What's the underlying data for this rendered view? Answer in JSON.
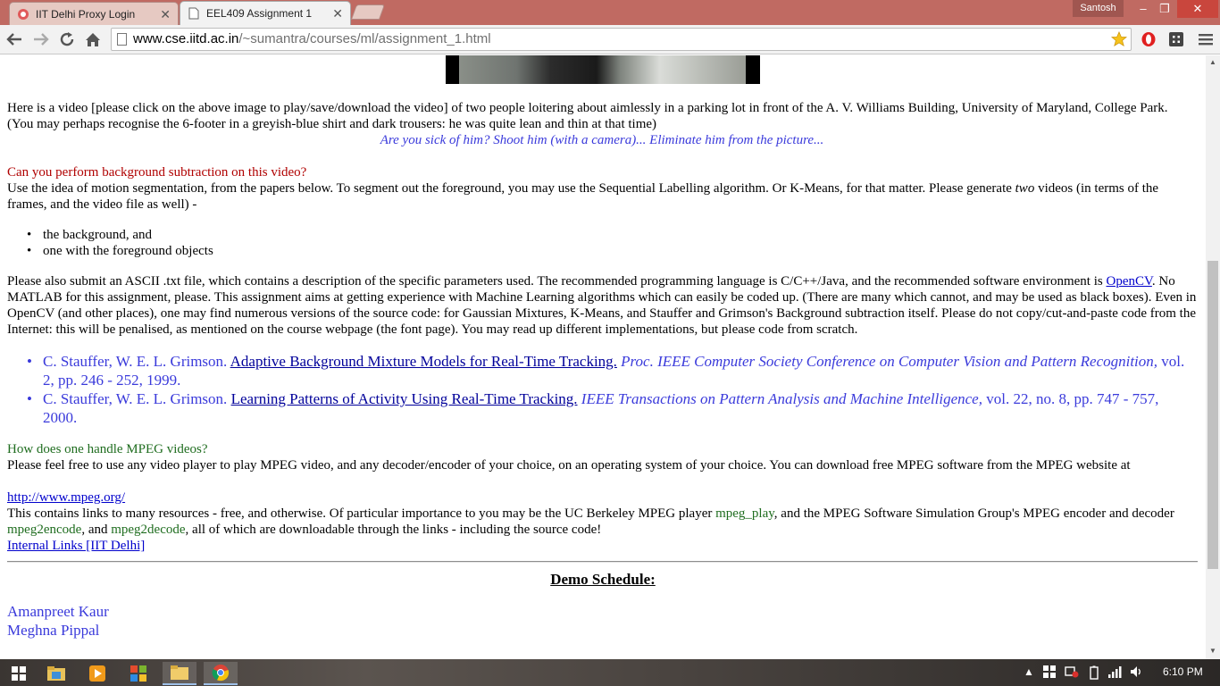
{
  "browser": {
    "tabs": [
      {
        "title": "IIT Delhi Proxy Login",
        "active": false
      },
      {
        "title": "EEL409 Assignment 1",
        "active": true
      }
    ],
    "user_name": "Santosh",
    "url_host": "www.cse.iitd.ac.in",
    "url_path": "/~sumantra/courses/ml/assignment_1.html",
    "window_controls": {
      "minimize": "–",
      "maximize": "❐",
      "close": "✕"
    }
  },
  "content": {
    "intro": "Here is a video [please click on the above image to play/save/download the video] of two people loitering about aimlessly in a parking lot in front of the A. V. Williams Building, University of Maryland, College Park. (You may perhaps recognise the 6-footer in a greyish-blue shirt and dark trousers: he was quite lean and thin at that time)",
    "tagline": "Are you sick of him? Shoot him (with a camera)... Eliminate him from the picture...",
    "question_bg": "Can you perform background subtraction on this video?",
    "bg_para_before_em": "Use the idea of motion segmentation, from the papers below. To segment out the foreground, you may use the Sequential Labelling algorithm. Or K-Means, for that matter. Please generate ",
    "bg_para_em": "two",
    "bg_para_after_em": " videos (in terms of the frames, and the video file as well) -",
    "outputs": [
      "the background, and",
      "one with the foreground objects"
    ],
    "submit_before_link": "Please also submit an ASCII .txt file, which contains a description of the specific parameters used. The recommended programming language is C/C++/Java, and the recommended software environment is ",
    "submit_link": "OpenCV",
    "submit_after_link": ". No MATLAB for this assignment, please. This assignment aims at getting experience with Machine Learning algorithms which can easily be coded up. (There are many which cannot, and may be used as black boxes). Even in OpenCV (and other places), one may find numerous versions of the source code: for Gaussian Mixtures, K-Means, and Stauffer and Grimson's Background subtraction itself. Please do not copy/cut-and-paste code from the Internet: this will be penalised, as mentioned on the course webpage (the font page). You may read up different implementations, but please code from scratch.",
    "references": [
      {
        "authors": "C. Stauffer, W. E. L. Grimson. ",
        "title": "Adaptive Background Mixture Models for Real-Time Tracking.",
        "venue": " Proc. IEEE Computer Society Conference on Computer Vision and Pattern Recognition,",
        "details": " vol. 2, pp. 246 - 252, 1999."
      },
      {
        "authors": "C. Stauffer, W. E. L. Grimson. ",
        "title": "Learning Patterns of Activity Using Real-Time Tracking.",
        "venue": " IEEE Transactions on Pattern Analysis and Machine Intelligence,",
        "details": " vol. 22, no. 8, pp. 747 - 757, 2000."
      }
    ],
    "question_mpeg": "How does one handle MPEG videos?",
    "mpeg_para": "Please feel free to use any video player to play MPEG video, and any decoder/encoder of your choice, on an operating system of your choice. You can download free MPEG software from the MPEG website at",
    "mpeg_link": "http://www.mpeg.org/",
    "links_para_1": "This contains links to many resources - free, and otherwise. Of particular importance to you may be the UC Berkeley MPEG player ",
    "tool_play": "mpeg_play",
    "links_para_2": ", and the MPEG Software Simulation Group's MPEG encoder and decoder ",
    "tool_encode": "mpeg2encode",
    "links_para_3": ", and ",
    "tool_decode": "mpeg2decode",
    "links_para_4": ", all of which are downloadable through the links - including the source code!",
    "internal_links": "Internal Links [IIT Delhi]",
    "demo_heading": "Demo Schedule:",
    "students": [
      "Amanpreet Kaur",
      "Meghna Pippal"
    ]
  },
  "taskbar": {
    "clock": "6:10 PM"
  }
}
